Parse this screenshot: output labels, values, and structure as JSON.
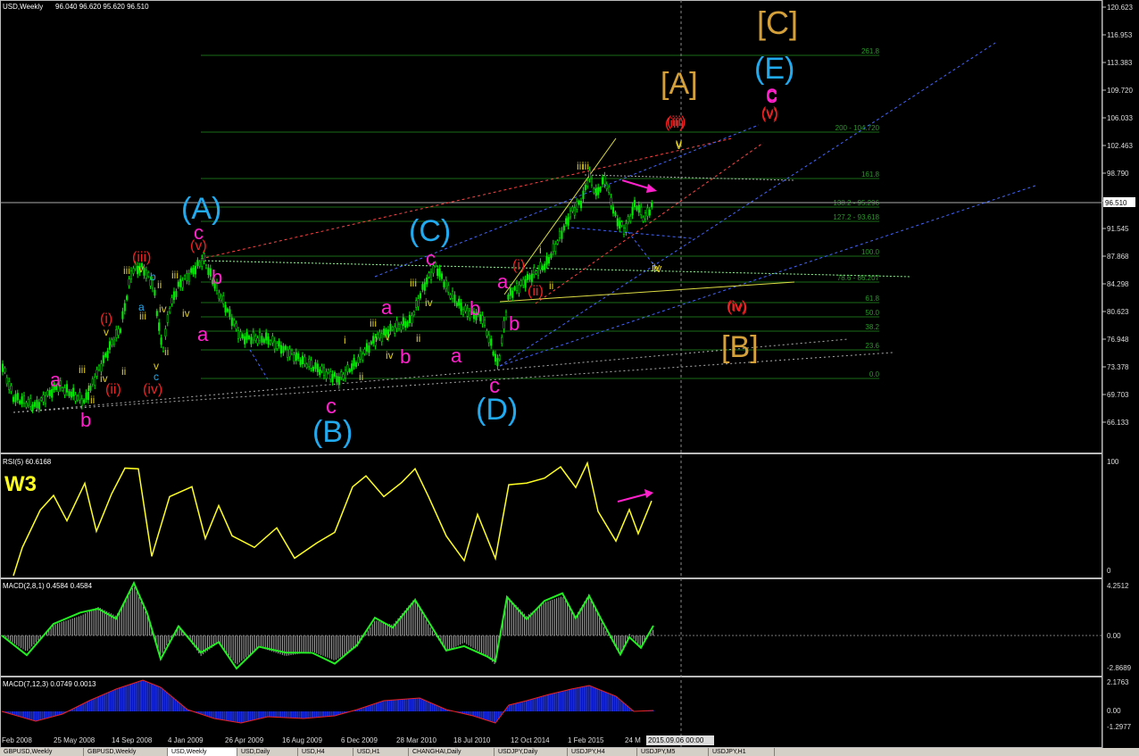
{
  "window": {
    "title": "USD,Weekly",
    "ohlc": "96.040 96.620 95.620 96.510",
    "current_price": "96.510",
    "time_readout": "2015.09.06 00:00"
  },
  "price_axis": [
    "120.623",
    "116.953",
    "113.383",
    "109.720",
    "106.033",
    "102.463",
    "98.790",
    "95.218",
    "91.545",
    "87.868",
    "84.298",
    "80.623",
    "76.948",
    "73.378",
    "69.703",
    "66.133"
  ],
  "time_axis": [
    "Feb 2008",
    "25 May 2008",
    "14 Sep 2008",
    "4 Jan 2009",
    "26 Apr 2009",
    "16 Aug 2009",
    "6 Dec 2009",
    "28 Mar 2010",
    "18 Jul 2010",
    "12 Oct 2014",
    "1 Feb 2015",
    "24 M"
  ],
  "fib_levels": [
    "261.8",
    "200 - 104.720",
    "161.8",
    "138.2 - 95.296",
    "127.2 - 93.618",
    "100.0",
    "78.6 - 86.207",
    "61.8",
    "50.0",
    "38.2",
    "23.6",
    "0.0"
  ],
  "wave_labels": [
    {
      "t": "[C]",
      "c": "#d4a03a"
    },
    {
      "t": "[A]",
      "c": "#d4a03a"
    },
    {
      "t": "[B]",
      "c": "#d4a03a"
    },
    {
      "t": "(E)",
      "c": "#22aaee"
    },
    {
      "t": "(A)",
      "c": "#22aaee"
    },
    {
      "t": "(C)",
      "c": "#22aaee"
    },
    {
      "t": "(B)",
      "c": "#22aaee"
    },
    {
      "t": "(D)",
      "c": "#22aaee"
    },
    {
      "t": "c",
      "c": "#ff22cc"
    },
    {
      "t": "(v)",
      "c": "#ee2222"
    },
    {
      "t": "(iii)",
      "c": "#ee2222"
    },
    {
      "t": "v",
      "c": "#ddcc22"
    },
    {
      "t": "iii",
      "c": "#ddcc22"
    },
    {
      "t": "iv",
      "c": "#ddcc22"
    },
    {
      "t": "(iv)",
      "c": "#ee2222"
    },
    {
      "t": "c",
      "c": "#ff22cc"
    },
    {
      "t": "(v)",
      "c": "#ee2222"
    },
    {
      "t": "b",
      "c": "#ff22cc"
    },
    {
      "t": "a",
      "c": "#ff22cc"
    },
    {
      "t": "(iii)",
      "c": "#ee2222"
    },
    {
      "t": "iii",
      "c": "#ddcc22"
    },
    {
      "t": "b",
      "c": "#22aaee"
    },
    {
      "t": "v",
      "c": "#ddcc22"
    },
    {
      "t": "a",
      "c": "#22aaee"
    },
    {
      "t": "ii",
      "c": "#ddcc22"
    },
    {
      "t": "iv",
      "c": "#ddcc22"
    },
    {
      "t": "iv",
      "c": "#ddcc22"
    },
    {
      "t": "iii",
      "c": "#ddcc22"
    },
    {
      "t": "iii",
      "c": "#ddcc22"
    },
    {
      "t": "ii",
      "c": "#ddcc22"
    },
    {
      "t": "v",
      "c": "#ddcc22"
    },
    {
      "t": "c",
      "c": "#22aaee"
    },
    {
      "t": "(iv)",
      "c": "#ee2222"
    },
    {
      "t": "(i)",
      "c": "#ee2222"
    },
    {
      "t": "v",
      "c": "#ddcc22"
    },
    {
      "t": "iii",
      "c": "#ddcc22"
    },
    {
      "t": "iv",
      "c": "#ddcc22"
    },
    {
      "t": "i",
      "c": "#ddcc22"
    },
    {
      "t": "ii",
      "c": "#ddcc22"
    },
    {
      "t": "(ii)",
      "c": "#ee2222"
    },
    {
      "t": "ii",
      "c": "#ddcc22"
    },
    {
      "t": "a",
      "c": "#ff22cc"
    },
    {
      "t": "b",
      "c": "#ff22cc"
    },
    {
      "t": "c",
      "c": "#ff22cc"
    },
    {
      "t": "i",
      "c": "#ddcc22"
    },
    {
      "t": "ii",
      "c": "#ddcc22"
    },
    {
      "t": "c",
      "c": "#ff22cc"
    },
    {
      "t": "iii",
      "c": "#ddcc22"
    },
    {
      "t": "iv",
      "c": "#ddcc22"
    },
    {
      "t": "a",
      "c": "#ff22cc"
    },
    {
      "t": "v",
      "c": "#ddcc22"
    },
    {
      "t": "iii",
      "c": "#ddcc22"
    },
    {
      "t": "i",
      "c": "#ddcc22"
    },
    {
      "t": "iv",
      "c": "#ddcc22"
    },
    {
      "t": "ii",
      "c": "#ddcc22"
    },
    {
      "t": "b",
      "c": "#ff22cc"
    },
    {
      "t": "b",
      "c": "#ff22cc"
    },
    {
      "t": "a",
      "c": "#ff22cc"
    },
    {
      "t": "c",
      "c": "#ff22cc"
    },
    {
      "t": "a",
      "c": "#ff22cc"
    },
    {
      "t": "(i)",
      "c": "#ee2222"
    },
    {
      "t": "i",
      "c": "#ddcc22"
    },
    {
      "t": "(ii)",
      "c": "#ee2222"
    },
    {
      "t": "ii",
      "c": "#ddcc22"
    },
    {
      "t": "b",
      "c": "#ff22cc"
    },
    {
      "t": "iii",
      "c": "#ddcc22"
    },
    {
      "t": "(iii)",
      "c": "#ee2222"
    },
    {
      "t": "v",
      "c": "#ddcc22"
    },
    {
      "t": "iv",
      "c": "#ddcc22"
    },
    {
      "t": "(iv)",
      "c": "#ee2222"
    },
    {
      "t": "c",
      "c": "#ff22cc"
    },
    {
      "t": "(v)",
      "c": "#ee2222"
    }
  ],
  "rsi": {
    "title": "RSI(5) 60.6168",
    "annotation": "W3",
    "scale": [
      "100",
      "0"
    ]
  },
  "macd1": {
    "title": "MACD(2,8,1) 0.4584 0.4584",
    "scale": [
      "4.2512",
      "0.00",
      "-2.8689"
    ]
  },
  "macd2": {
    "title": "MACD(7,12,3) 0.0749 0.0013",
    "scale": [
      "2.1763",
      "0.00",
      "-1.2977"
    ]
  },
  "tabs": [
    "GBPUSD,Weekly",
    "GBPUSD,Weekly",
    "USD,Weekly",
    "USD,Daily",
    "USD,H4",
    "USD,H1",
    "CHANGHAI,Daily",
    "USDJPY,Daily",
    "USDJPY,H4",
    "USDJPY,M5",
    "USDJPY,H1"
  ],
  "colors": {
    "candle": "#00ee00",
    "rsi": "#ffff22",
    "macd_line": "#22ee22",
    "signal": "#ee2222",
    "hist2": "#1a2bdd",
    "grid": "#1f8f1f",
    "fib": "#1a6b1a"
  },
  "chart_data": {
    "type": "line",
    "title": "USD,Weekly",
    "ylim": [
      66.133,
      120.623
    ],
    "x": [
      "Feb 2008",
      "25 May 2008",
      "14 Sep 2008",
      "4 Jan 2009",
      "26 Apr 2009",
      "16 Aug 2009",
      "6 Dec 2009",
      "28 Mar 2010",
      "18 Jul 2010",
      "12 Oct 2014",
      "1 Feb 2015",
      "24 M"
    ],
    "series": [
      {
        "name": "USD,Weekly",
        "values": [
          74.5,
          72.5,
          84.5,
          88.5,
          79.5,
          76.0,
          78.0,
          86.0,
          82.0,
          86.5,
          100.0,
          96.5
        ]
      }
    ]
  }
}
